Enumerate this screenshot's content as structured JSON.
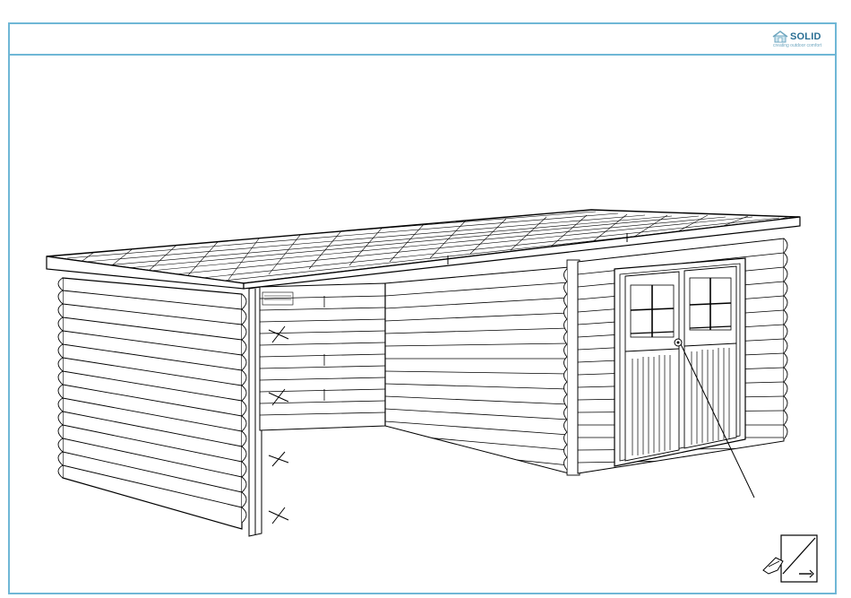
{
  "brand": {
    "name": "SOLID",
    "tagline": "creating outdoor comfort",
    "accent_color": "#6fb7d6",
    "brand_color": "#2a6f94"
  },
  "diagram": {
    "subject": "log-cabin-with-open-carport-line-drawing",
    "icons": [
      "house-icon",
      "page-turn-icon"
    ]
  }
}
